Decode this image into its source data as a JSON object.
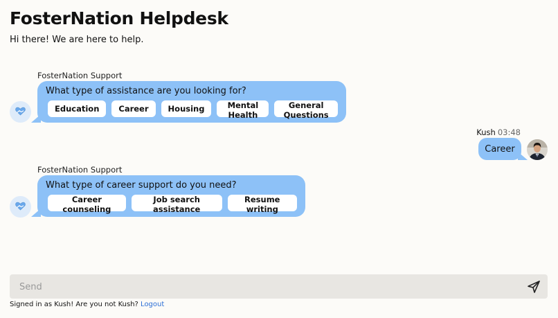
{
  "header": {
    "title": "FosterNation Helpdesk",
    "subtitle": "Hi there! We are here to help."
  },
  "messages": [
    {
      "sender": "FosterNation Support",
      "question": "What type of assistance are you looking for?",
      "options": [
        "Education",
        "Career",
        "Housing",
        "Mental Health",
        "General Questions"
      ]
    },
    {
      "sender": "Kush",
      "time": "03:48",
      "text": "Career"
    },
    {
      "sender": "FosterNation Support",
      "question": "What type of career support do you need?",
      "options": [
        "Career counseling",
        "Job search assistance",
        "Resume writing"
      ]
    }
  ],
  "composer": {
    "placeholder": "Send",
    "send_icon": "paper-plane-icon"
  },
  "footer": {
    "signed_in_text": "Signed in as Kush! Are you not Kush?",
    "logout_label": "Logout"
  },
  "colors": {
    "bubble": "#8dc1f7",
    "background": "#fcfbf8",
    "composer": "#e8e6e2",
    "link": "#2b6ed6"
  }
}
